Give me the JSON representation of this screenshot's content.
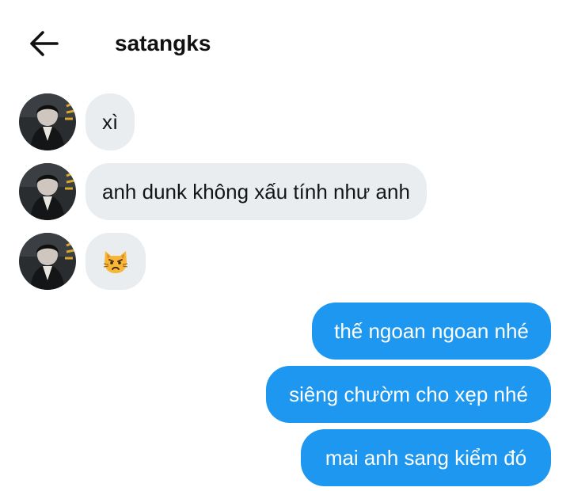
{
  "header": {
    "title": "satangks",
    "back_icon": "arrow-left-icon"
  },
  "colors": {
    "incoming_bubble": "#e9edf0",
    "outgoing_bubble": "#1d97f0"
  },
  "messages": [
    {
      "direction": "incoming",
      "type": "text",
      "text": "xì"
    },
    {
      "direction": "incoming",
      "type": "text",
      "text": "anh dunk không xấu tính như anh"
    },
    {
      "direction": "incoming",
      "type": "emoji",
      "emoji": "pouting-cat-emoji"
    },
    {
      "direction": "outgoing",
      "type": "text",
      "text": "thế ngoan ngoan nhé"
    },
    {
      "direction": "outgoing",
      "type": "text",
      "text": "siêng chườm cho xẹp nhé"
    },
    {
      "direction": "outgoing",
      "type": "text",
      "text": "mai anh sang kiểm đó"
    }
  ]
}
